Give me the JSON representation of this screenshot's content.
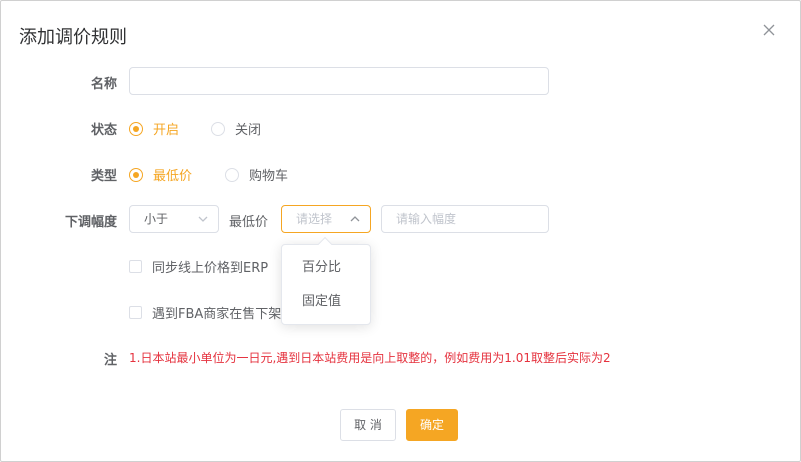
{
  "dialog": {
    "title": "添加调价规则",
    "close_icon": "close-icon"
  },
  "form": {
    "name": {
      "label": "名称",
      "value": "",
      "placeholder": ""
    },
    "status": {
      "label": "状态",
      "options": [
        {
          "label": "开启",
          "checked": true
        },
        {
          "label": "关闭",
          "checked": false
        }
      ]
    },
    "type": {
      "label": "类型",
      "options": [
        {
          "label": "最低价",
          "checked": true
        },
        {
          "label": "购物车",
          "checked": false
        }
      ]
    },
    "adjust": {
      "label": "下调幅度",
      "comparator": "小于",
      "inline_label": "最低价",
      "unit_placeholder": "请选择",
      "amount_placeholder": "请输入幅度",
      "dropdown_options": [
        "百分比",
        "固定值"
      ]
    },
    "checkboxes": [
      {
        "label": "同步线上价格到ERP",
        "checked": false
      },
      {
        "label": "遇到FBA商家在售下架",
        "checked": false
      }
    ],
    "note": {
      "label": "注",
      "text": "1.日本站最小单位为一日元,遇到日本站费用是向上取整的，例如费用为1.01取整后实际为2"
    }
  },
  "footer": {
    "cancel_label": "取 消",
    "confirm_label": "确定"
  },
  "colors": {
    "accent": "#f5a623",
    "note": "#e5323e",
    "border": "#dcdfe6"
  }
}
